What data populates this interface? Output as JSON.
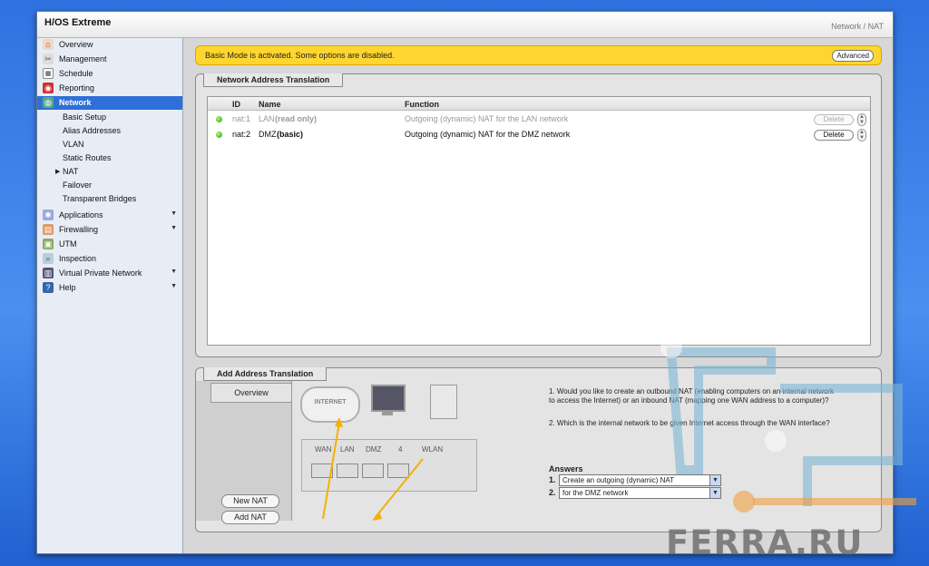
{
  "app": {
    "title": "H/OS Extreme",
    "breadcrumb": "Network / NAT"
  },
  "sidebar": {
    "items": [
      {
        "label": "Overview",
        "icon": "home-icon"
      },
      {
        "label": "Management",
        "icon": "tools-icon"
      },
      {
        "label": "Schedule",
        "icon": "calendar-icon"
      },
      {
        "label": "Reporting",
        "icon": "report-icon"
      },
      {
        "label": "Network",
        "icon": "network-icon"
      },
      {
        "label": "Applications",
        "icon": "applications-icon"
      },
      {
        "label": "Firewalling",
        "icon": "firewall-icon"
      },
      {
        "label": "UTM",
        "icon": "utm-icon"
      },
      {
        "label": "Inspection",
        "icon": "inspection-icon"
      },
      {
        "label": "Virtual Private Network",
        "icon": "vpn-icon"
      },
      {
        "label": "Help",
        "icon": "help-icon"
      }
    ],
    "network_sub": [
      "Basic Setup",
      "Alias Addresses",
      "VLAN",
      "Static Routes",
      "NAT",
      "Failover",
      "Transparent Bridges"
    ]
  },
  "notice": {
    "text": "Basic Mode is activated. Some options are disabled.",
    "button": "Advanced"
  },
  "nat_panel": {
    "title": "Network Address Translation",
    "columns": [
      "ID",
      "Name",
      "Function"
    ],
    "rows": [
      {
        "id": "nat:1",
        "name": "LAN",
        "mode": "(read only)",
        "function": "Outgoing (dynamic) NAT for the LAN network",
        "delete": "Delete"
      },
      {
        "id": "nat:2",
        "name": "DMZ",
        "mode": "(basic)",
        "function": "Outgoing (dynamic) NAT for the DMZ network",
        "delete": "Delete"
      }
    ]
  },
  "add_panel": {
    "title": "Add Address Translation",
    "tab": "Overview",
    "new_button": "New NAT",
    "add_button": "Add NAT",
    "cloud_label": "INTERNET",
    "ports": [
      "WAN",
      "LAN",
      "DMZ",
      "4",
      "WLAN"
    ],
    "q1": "1. Would you like to create an outbound NAT (enabling computers on an internal network to access the Internet) or an inbound NAT (mapping one WAN address to a computer)?",
    "q2": "2. Which is the internal network to be given Internet access through the WAN interface?",
    "answers_title": "Answers",
    "answer1_num": "1.",
    "answer1": "Create an outgoing (dynamic) NAT",
    "answer2_num": "2.",
    "answer2": "for the DMZ network"
  },
  "watermark": "FERRA.RU"
}
